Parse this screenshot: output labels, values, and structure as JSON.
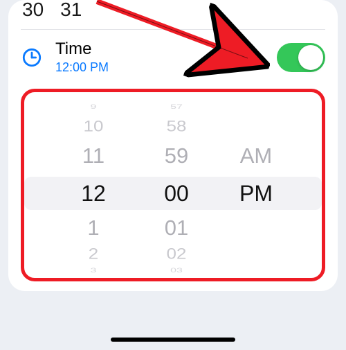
{
  "calendar": {
    "d1": "30",
    "d2": "31"
  },
  "time_row": {
    "title": "Time",
    "subtitle": "12:00 PM"
  },
  "colors": {
    "accent": "#0a7aff",
    "switch_on": "#34c759",
    "highlight_border": "#ee1c25"
  },
  "picker": {
    "hours": {
      "m3": "9",
      "m2": "10",
      "m1": "11",
      "sel": "12",
      "p1": "1",
      "p2": "2",
      "p3": "3"
    },
    "minutes": {
      "m3": "57",
      "m2": "58",
      "m1": "59",
      "sel": "00",
      "p1": "01",
      "p2": "02",
      "p3": "03"
    },
    "ampm": {
      "m1": "AM",
      "sel": "PM"
    }
  }
}
